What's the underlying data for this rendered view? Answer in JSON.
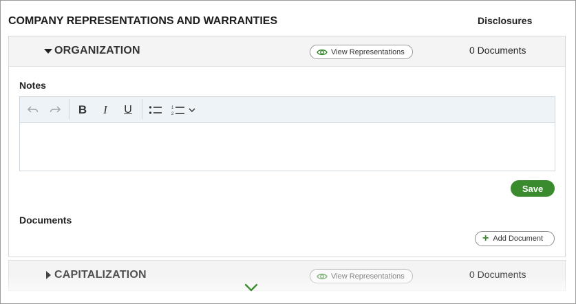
{
  "page": {
    "title": "COMPANY REPRESENTATIONS AND WARRANTIES",
    "column_header": "Disclosures"
  },
  "sections": [
    {
      "title": "ORGANIZATION",
      "expanded": true,
      "view_button_label": "View Representations",
      "doc_count_label": "0 Documents",
      "notes_label": "Notes",
      "editor": {
        "toolbar": [
          "undo-icon",
          "redo-icon",
          "bold-icon",
          "italic-icon",
          "underline-icon",
          "bullet-list-icon",
          "numbered-list-icon",
          "chevron-down-icon"
        ],
        "value": ""
      },
      "save_label": "Save",
      "documents_label": "Documents",
      "add_document_label": "Add Document"
    },
    {
      "title": "CAPITALIZATION",
      "expanded": false,
      "view_button_label": "View Representations",
      "doc_count_label": "0 Documents"
    }
  ],
  "colors": {
    "accent_green": "#3a8a2e",
    "section_header_bg": "#f4f4f4",
    "toolbar_bg": "#eef3f7"
  },
  "scroll_indicator": "chevron-down-icon"
}
